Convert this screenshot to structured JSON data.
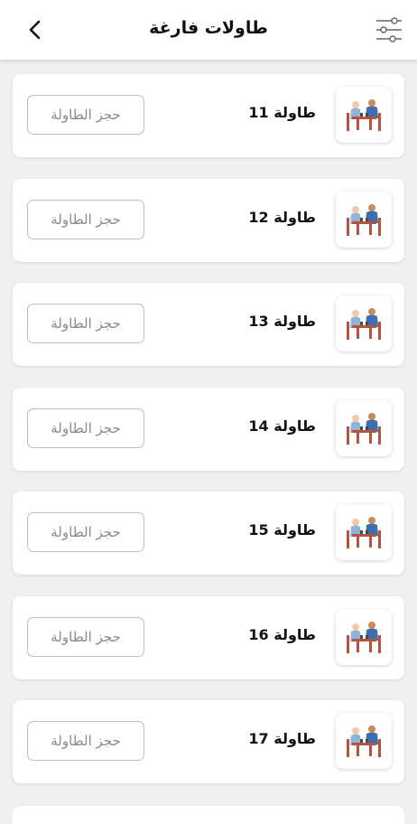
{
  "header": {
    "title": "طاولات فارغة",
    "back_icon": "chevron-left-icon",
    "filter_icon": "sliders-icon"
  },
  "tables": [
    {
      "name": "طاولة 11",
      "button_label": "حجز الطاولة",
      "icon": "people-at-table-icon"
    },
    {
      "name": "طاولة 12",
      "button_label": "حجز الطاولة",
      "icon": "people-at-table-icon"
    },
    {
      "name": "طاولة 13",
      "button_label": "حجز الطاولة",
      "icon": "people-at-table-icon"
    },
    {
      "name": "طاولة 14",
      "button_label": "حجز الطاولة",
      "icon": "people-at-table-icon"
    },
    {
      "name": "طاولة 15",
      "button_label": "حجز الطاولة",
      "icon": "people-at-table-icon"
    },
    {
      "name": "طاولة 16",
      "button_label": "حجز الطاولة",
      "icon": "people-at-table-icon"
    },
    {
      "name": "طاولة 17",
      "button_label": "حجز الطاولة",
      "icon": "people-at-table-icon"
    }
  ]
}
